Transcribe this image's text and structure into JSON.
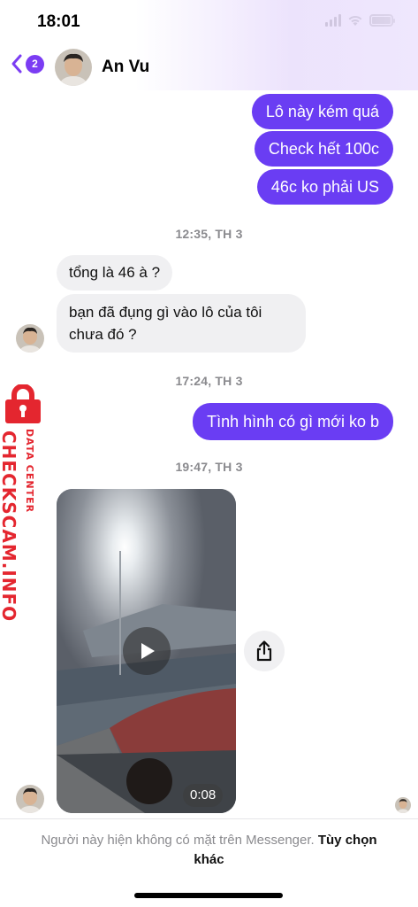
{
  "status_bar": {
    "time": "18:01"
  },
  "header": {
    "back_count": "2",
    "contact_name": "An Vu"
  },
  "messages": {
    "out_1": "Lô này kém quá",
    "out_2": "Check hết 100c",
    "out_3": "46c ko phải US",
    "ts_1": "12:35, TH 3",
    "in_1": "tổng là 46 à ?",
    "in_2_line1": "bạn đã đụng gì vào lô của tôi",
    "in_2_line2": "chưa đó ?",
    "ts_2": "17:24, TH 3",
    "out_4": "Tình hình có gì mới ko b",
    "ts_3": "19:47, TH 3"
  },
  "video": {
    "duration": "0:08"
  },
  "watermark": {
    "main": "CHECKSCAM.INFO",
    "sub": "DATA CENTER"
  },
  "footer": {
    "notice": "Người này hiện không có mặt trên Messenger.",
    "link": "Tùy chọn khác"
  },
  "colors": {
    "accent": "#6a3df3",
    "badge": "#7b3cf3",
    "incoming_bubble": "#f0f0f2",
    "watermark": "#e4262f"
  },
  "icons": [
    "back-chevron-icon",
    "signal-icon",
    "wifi-icon",
    "battery-icon",
    "play-icon",
    "share-icon",
    "lock-icon"
  ]
}
